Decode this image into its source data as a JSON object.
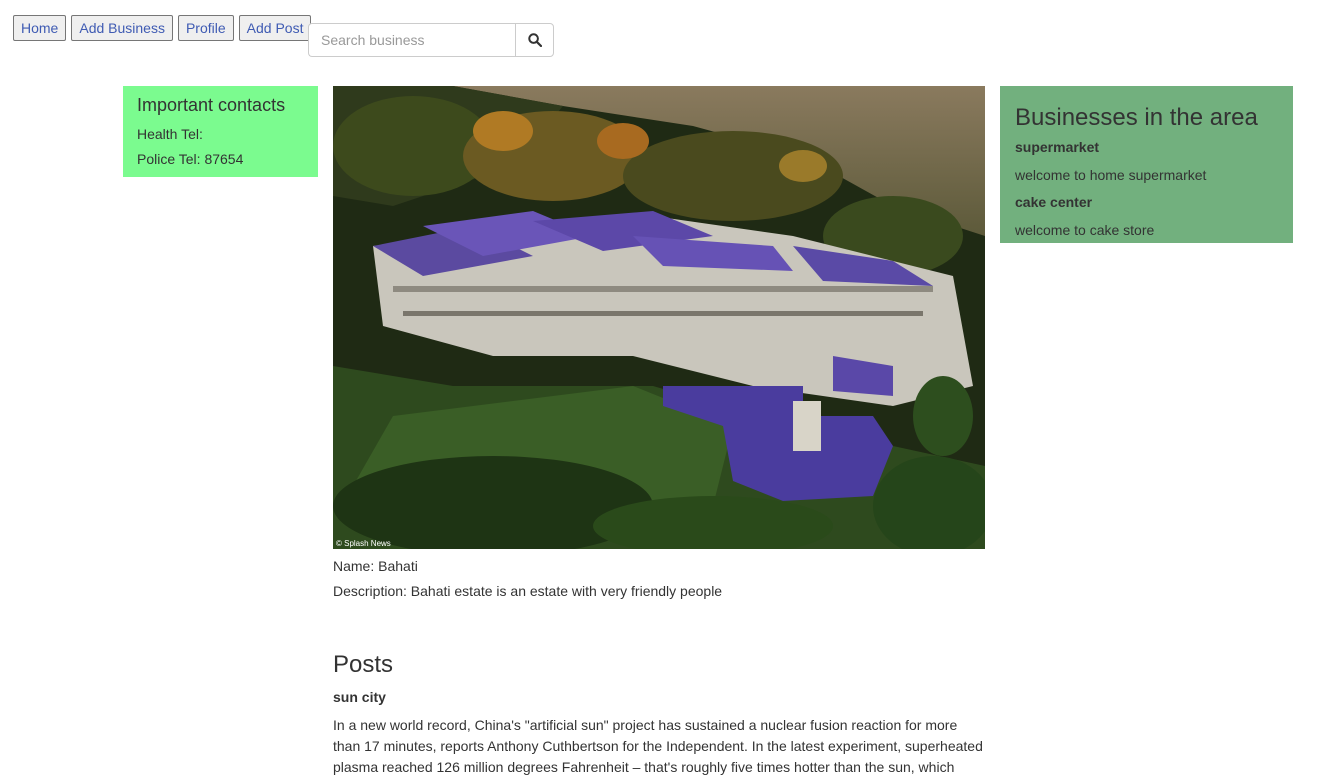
{
  "nav": {
    "items": [
      {
        "label": "Home"
      },
      {
        "label": "Add Business"
      },
      {
        "label": "Profile"
      },
      {
        "label": "Add Post"
      }
    ]
  },
  "search": {
    "placeholder": "Search business",
    "icon": "search-icon"
  },
  "contacts": {
    "title": "Important contacts",
    "health": "Health Tel:",
    "police": "Police Tel: 87654"
  },
  "neighbourhood": {
    "image_alt": "aerial view of estate",
    "image_credit": "© Splash News",
    "name": "Name: Bahati",
    "description": "Description: Bahati estate is an estate with very friendly people"
  },
  "posts": {
    "heading": "Posts",
    "items": [
      {
        "title": "sun city",
        "body": "In a new world record, China's \"artificial sun\" project has sustained a nuclear fusion reaction for more than 17 minutes, reports Anthony Cuthbertson for the Independent. In the latest experiment, superheated plasma reached 126 million degrees Fahrenheit – that's roughly five times hotter than the sun, which"
      }
    ]
  },
  "businesses": {
    "title": "Businesses in the area",
    "items": [
      {
        "name": "supermarket",
        "description": "welcome to home supermarket"
      },
      {
        "name": "cake center",
        "description": "welcome to cake store"
      }
    ]
  },
  "colors": {
    "contacts_bg": "#7bfb8f",
    "businesses_bg": "#72b07e",
    "nav_link": "#3f5bb3"
  }
}
